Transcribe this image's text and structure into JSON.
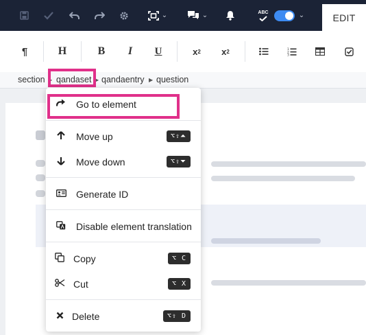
{
  "editor": {
    "edit_tab": "EDIT",
    "spellcheck_label": "ABC"
  },
  "toolbar": {
    "paragraph": "¶",
    "heading": "H",
    "bold": "B",
    "italic": "I",
    "underline": "U",
    "superscript_base": "x",
    "superscript_mark": "2",
    "subscript_base": "x",
    "subscript_mark": "2"
  },
  "breadcrumb": [
    "section",
    "qandaset",
    "qandaentry",
    "question"
  ],
  "context_menu": {
    "items": [
      {
        "label": "Go to element",
        "icon": "redo-arrow-icon",
        "shortcut": ""
      },
      {
        "label": "Move up",
        "icon": "arrow-up-icon",
        "shortcut": "⌥⇧⏶"
      },
      {
        "label": "Move down",
        "icon": "arrow-down-icon",
        "shortcut": "⌥⇧⏷"
      },
      {
        "label": "Generate ID",
        "icon": "id-card-icon",
        "shortcut": ""
      },
      {
        "label": "Disable element translation",
        "icon": "translate-icon",
        "shortcut": ""
      },
      {
        "label": "Copy",
        "icon": "copy-icon",
        "shortcut": "⌥ C"
      },
      {
        "label": "Cut",
        "icon": "scissors-icon",
        "shortcut": "⌥ X"
      },
      {
        "label": "Delete",
        "icon": "close-icon",
        "shortcut": "⌥⇧ D"
      }
    ]
  },
  "colors": {
    "topbar": "#1b2336",
    "highlight": "#e0308a",
    "toggle": "#3d8bf2"
  }
}
